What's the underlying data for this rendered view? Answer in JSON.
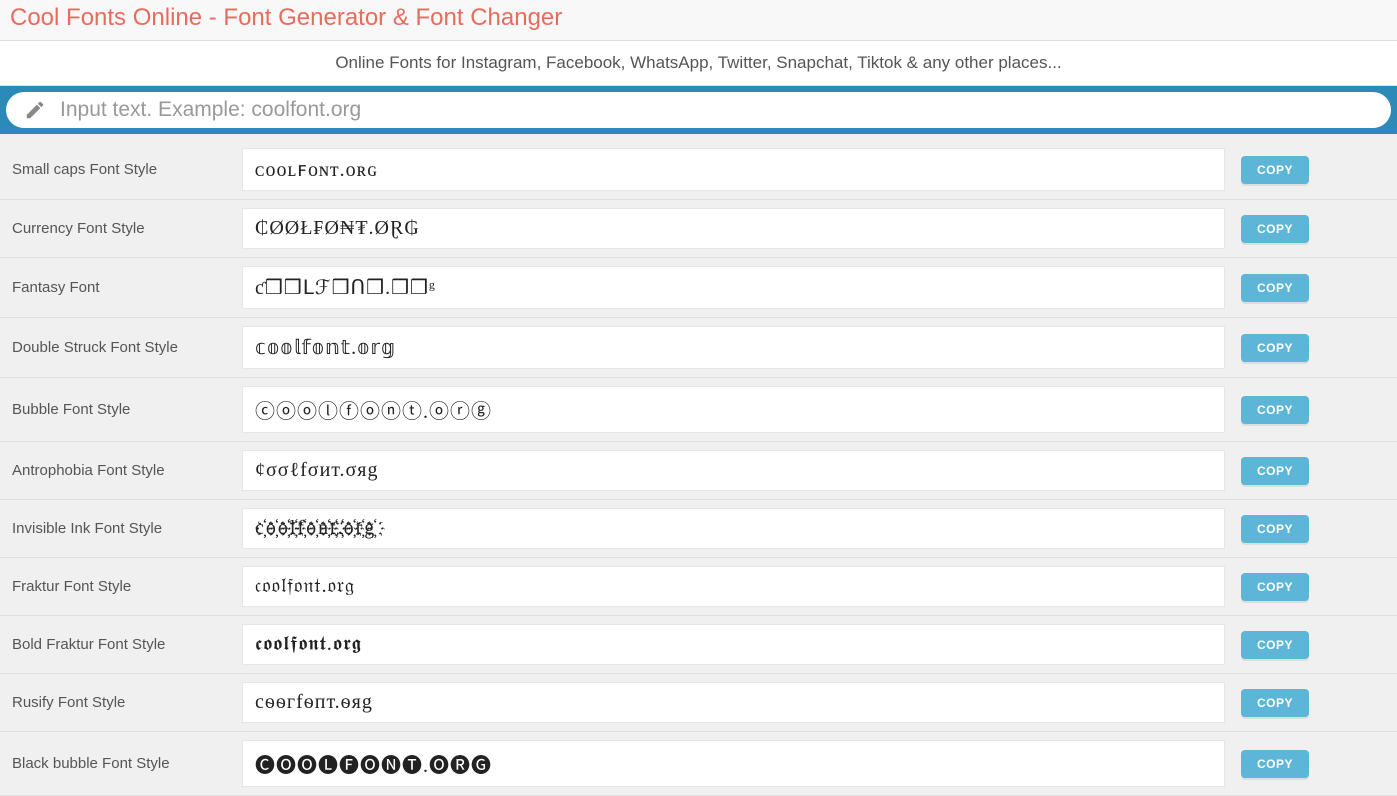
{
  "header": {
    "title": "Cool Fonts Online - Font Generator & Font Changer",
    "subtitle": "Online Fonts for Instagram, Facebook, WhatsApp, Twitter, Snapchat, Tiktok & any other places..."
  },
  "input": {
    "placeholder": "Input text. Example: coolfont.org",
    "value": ""
  },
  "copy_label": "COPY",
  "styles": [
    {
      "label": "Small caps Font Style",
      "output": "ᴄᴏᴏʟꜰᴏɴᴛ.ᴏʀɢ"
    },
    {
      "label": "Currency Font Style",
      "output": "₵ØØŁ₣Ø₦₮.ØⱤ₲"
    },
    {
      "label": "Fantasy Font",
      "output": "ƈ❒❒ᒪℱ❒ᑎ❒.❒❒ᵍ"
    },
    {
      "label": "Double Struck Font Style",
      "output": "𝕔𝕠𝕠𝕝𝕗𝕠𝕟𝕥.𝕠𝕣𝕘"
    },
    {
      "label": "Bubble Font Style",
      "output": "ⓒⓞⓞⓛⓕⓞⓝⓣ.ⓞⓡⓖ"
    },
    {
      "label": "Antrophobia Font Style",
      "output": "¢σσℓfσит.σяg"
    },
    {
      "label": "Invisible Ink Font Style",
      "output": "c҉o҉o҉l҉f҉o҉n҉t҉.҉o҉r҉g҉"
    },
    {
      "label": "Fraktur Font Style",
      "output": "𝔠𝔬𝔬𝔩𝔣𝔬𝔫𝔱.𝔬𝔯𝔤"
    },
    {
      "label": "Bold Fraktur Font Style",
      "output": "𝖈𝖔𝖔𝖑𝖋𝖔𝖓𝖙.𝖔𝖗𝖌"
    },
    {
      "label": "Rusify Font Style",
      "output": "cѳѳгfѳпт.ѳяg"
    },
    {
      "label": "Black bubble Font Style",
      "output": "🅒🅞🅞🅛🅕🅞🅝🅣.🅞🅡🅖"
    }
  ]
}
